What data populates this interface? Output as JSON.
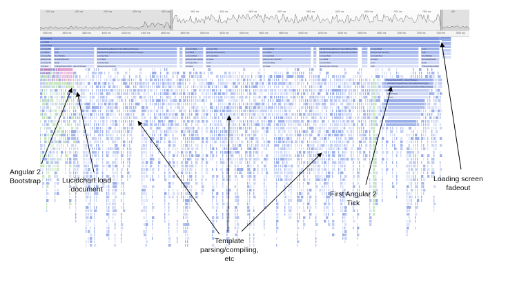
{
  "overview": {
    "ticks": [
      "1000 ms",
      "1500 ms",
      "2000 ms",
      "2500 ms",
      "3000 ms",
      "3500 ms",
      "4000 ms",
      "4500 ms",
      "5000 ms",
      "5500 ms",
      "6000 ms",
      "6500 ms",
      "7000 ms",
      "7500 ms",
      "800"
    ]
  },
  "ruler": {
    "ticks": [
      "3400 ms",
      "3600 ms",
      "3800 ms",
      "4000 ms",
      "4200 ms",
      "4400 ms",
      "4600 ms",
      "4800 ms",
      "5000 ms",
      "5200 ms",
      "5400 ms",
      "5600 ms",
      "5800 ms",
      "6000 ms",
      "6200 ms",
      "6400 ms",
      "6600 ms",
      "6800 ms",
      "7000 ms",
      "7200 ms",
      "7400 ms",
      "7600 ms"
    ]
  },
  "flame_labels": {
    "e": "a.invokeTask",
    "runtask": "e.runTask",
    "zone_invoke": "a.invokeTask",
    "anon": "(anonymous function)",
    "onInvokeTask": "onInvokeTask",
    "invoke": "a.invoke",
    "run": "e.run",
    "tick": "t.tick",
    "check": "checkStable",
    "bootstrap": "bootstrapModule",
    "load": "(load)",
    "detect": "ChangeDetectorRef_.detectChanges",
    "internal": "AbstractChangeDetector.internalDetectChanges",
    "children": "AbstractChangeDetector.detectViewChildrenChanges"
  },
  "annotations": {
    "bootstrap_line1": "Angular 2",
    "bootstrap_line2": "Bootstrap",
    "lucid_line1": "Lucidchart load",
    "lucid_line2": "document",
    "template_line1": "Template",
    "template_line2": "parsing/compiling,",
    "template_line3": "etc",
    "tick_line1": "First Angular 2",
    "tick_line2": "Tick",
    "fade_line1": "Loading screen",
    "fade_line2": "fadeout"
  }
}
